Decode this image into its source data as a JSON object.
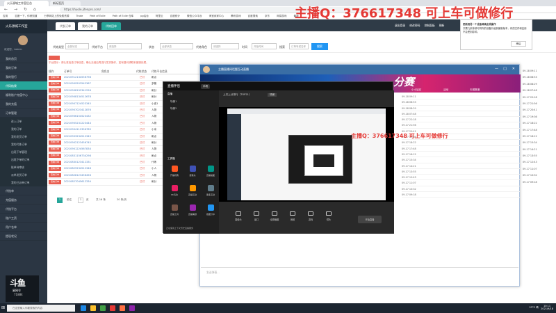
{
  "browser": {
    "tabs": [
      "火乐源城工作室后台",
      "新标签页"
    ],
    "url": "https://huole.jifenpro.com/"
  },
  "bookmarks": [
    "应用",
    "百度一下，你就知道",
    "分享网站上的免费资源",
    "Trade",
    "Path of Exile",
    "Path of Exile 仓库",
    "pg后台",
    "阿里云",
    "百度统计",
    "微信公众平台",
    "淘宝卖家中心",
    "腾讯游戏",
    "百度搜索",
    "京东",
    "网易游戏",
    "最新"
  ],
  "watermark": "主播Q：376617348 可上车可做修行",
  "notification": {
    "title": "更新到另一个设备继续此项操作",
    "body": "只需几秒钟即可将你的设备升级到最新版本，你的文件和应用不会受到影响。",
    "button": "稍后"
  },
  "sidebar": {
    "title": "火乐源城工作室",
    "user": "欢迎您，Admin",
    "items": [
      "我的首页",
      "我的订单",
      "我的银行",
      "代码结果",
      "福利账户充值中心",
      "我的充值",
      "订单管理"
    ],
    "subitems": [
      "进入订单",
      "我的订单",
      "我的发货订单",
      "我的代练订单",
      "出现下单管理",
      "出现下单的订单",
      "账单待审核",
      "派单发货订单",
      "我的已派单订单"
    ],
    "items2": [
      "代账单",
      "充值服务",
      "代账平台",
      "账户工资",
      "用户名单",
      "提现状况"
    ]
  },
  "topnav": {
    "tabs": [
      "代发订单",
      "我的订单",
      "代练回单"
    ],
    "right": [
      "退出登录",
      "修改密码",
      "控制面板",
      "刷新"
    ]
  },
  "filter": {
    "labels": [
      "代练类型",
      "代练平台",
      "状态",
      "代练角色",
      "时间",
      "搜索"
    ],
    "values": [
      "全部状态",
      "请选择",
      "全部状态",
      "请选择",
      "开始时间",
      "订单号或名称"
    ],
    "search_button": "搜索"
  },
  "notice": "平台提示：请认真检查订单信息，确认无误后再进行发货操作，如有疑问请联系客服处理。",
  "table": {
    "headers": [
      "操作",
      "订单号",
      "角色名",
      "代练状态",
      "代练平台信息"
    ],
    "rows": [
      {
        "btn": "查看订单",
        "id": "20210912134556798",
        "status": "已付",
        "text": "刷点"
      },
      {
        "btn": "查看订单",
        "id": "20210909203542367",
        "status": "已付",
        "text": "多管"
      },
      {
        "btn": "查看订单",
        "id": "20210908192341256",
        "status": "已付",
        "text": "刷分"
      },
      {
        "btn": "查看订单",
        "id": "20210908134512678",
        "status": "已付",
        "text": "刷分"
      },
      {
        "btn": "查看订单",
        "id": "20210907124523345",
        "status": "已付",
        "text": "小皮1"
      },
      {
        "btn": "查看订单",
        "id": "20210907023412876",
        "status": "已付",
        "text": "人物"
      },
      {
        "btn": "查看订单",
        "id": "20210906154523432",
        "status": "已付",
        "text": "人物"
      },
      {
        "btn": "查看订单",
        "id": "20210905231223444",
        "status": "已付",
        "text": "人物"
      },
      {
        "btn": "查看订单",
        "id": "20210904112356789",
        "status": "已付",
        "text": "小米"
      },
      {
        "btn": "查看订单",
        "id": "20210903234512345",
        "status": "已付",
        "text": "刷点"
      },
      {
        "btn": "查看订单",
        "id": "20210902123456745",
        "status": "已付",
        "text": "刷分"
      },
      {
        "btn": "查看订单",
        "id": "20210901224567834",
        "status": "已付",
        "text": "人物"
      },
      {
        "btn": "查看订单",
        "id": "20210831156734298",
        "status": "已付",
        "text": "刷点"
      },
      {
        "btn": "查看订单",
        "id": "20210830123412331",
        "status": "已付",
        "text": "代练"
      },
      {
        "btn": "查看订单",
        "id": "20210829234512348",
        "status": "已付",
        "text": "小人"
      },
      {
        "btn": "查看订单",
        "id": "20210828123456456",
        "status": "已付",
        "text": "人物"
      },
      {
        "btn": "查看订单",
        "id": "20210827045612334",
        "status": "已付",
        "text": "刷分"
      }
    ]
  },
  "pager": {
    "current": "1",
    "total_text": "共 16 条",
    "per_page": "20 条/页",
    "goto": "前往",
    "page_unit": "页"
  },
  "chat": {
    "title": "主播直播间话题互动直播",
    "banner_text": "分赛",
    "banner_labels": [
      "小小钻石",
      "活动",
      "天梯赛道"
    ],
    "input_placeholder": "发送弹幕...",
    "list": [
      "09-18 09:11",
      "09-18 08:53",
      "09-18 08:29",
      "09-18 07:48",
      "09-17 22:18",
      "09-17 21:56",
      "09-17 20:41",
      "09-17 19:36",
      "09-17 18:22",
      "09-17 17:48",
      "09-17 16:12",
      "09-17 15:34",
      "09-17 14:21",
      "09-17 13:55",
      "09-17 12:43",
      "09-17 11:07",
      "09-17 10:32",
      "09-17 09:18"
    ]
  },
  "tool": {
    "title": "直播伴侣",
    "version": "手机",
    "tabs": [
      "上次上分排行（TOP21）",
      "场景"
    ],
    "left_items": [
      "直播",
      "场景1",
      "场景2"
    ],
    "tools_label": "工具箱",
    "tools": [
      "开播视角",
      "摄像头",
      "直播画面",
      "PK玩法",
      "直播互动",
      "更多互动",
      "直播工具",
      "直播美颜",
      "截图分享"
    ],
    "buttons": [
      "摄像头",
      "窗口",
      "全屏截图",
      "音频",
      "游戏",
      "镜头",
      "开始直播"
    ],
    "status": "正在使用上下文历史直播服务"
  },
  "douyu": {
    "logo": "斗鱼",
    "sub": "星网号",
    "num": "71884"
  },
  "taskbar": {
    "search": "在这里输入你要搜索的内容",
    "temp": "23°C 晴",
    "time": "10:11",
    "date": "2021/9/18"
  },
  "colors": {
    "accent": "#26a69a",
    "danger": "#e95d4f",
    "watermark": "#e53935",
    "sidebar": "#2b3643"
  }
}
